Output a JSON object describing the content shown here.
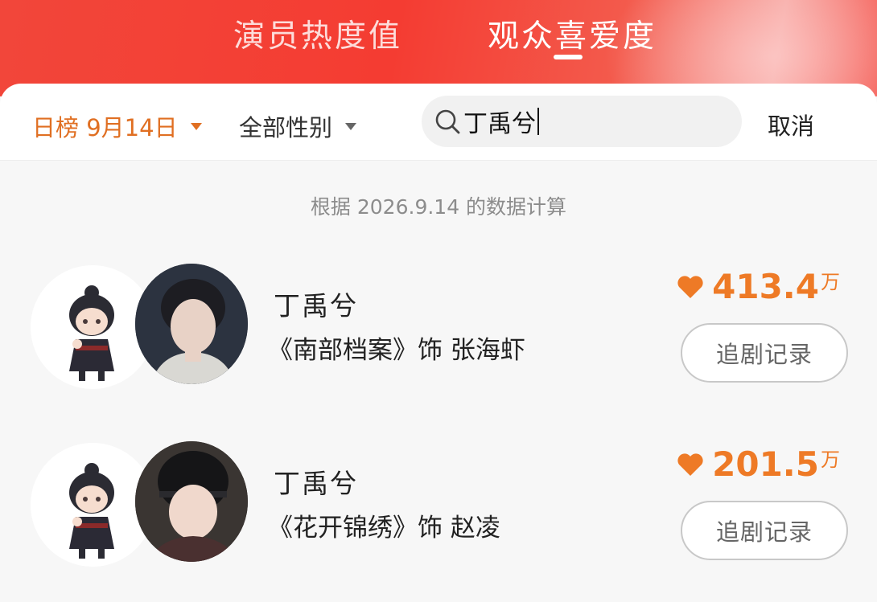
{
  "tabs": [
    {
      "label": "演员热度值",
      "active": false
    },
    {
      "label": "观众喜爱度",
      "active": true
    }
  ],
  "filters": {
    "date_label": "日榜 9月14日",
    "gender_label": "全部性别"
  },
  "search": {
    "value": "丁禹兮",
    "cancel_label": "取消"
  },
  "note": "根据 2026.9.14 的数据计算",
  "results": [
    {
      "name": "丁禹兮",
      "role": "《南部档案》饰 张海虾",
      "score": "413.4",
      "unit": "万",
      "button": "追剧记录"
    },
    {
      "name": "丁禹兮",
      "role": "《花开锦绣》饰 赵凌",
      "score": "201.5",
      "unit": "万",
      "button": "追剧记录"
    }
  ],
  "colors": {
    "header_red": "#f2463a",
    "accent_orange": "#e06f22",
    "score_orange": "#ee7a26"
  },
  "icons": {
    "search": "search-icon",
    "dropdown": "caret-down-icon",
    "heart": "heart-icon"
  }
}
